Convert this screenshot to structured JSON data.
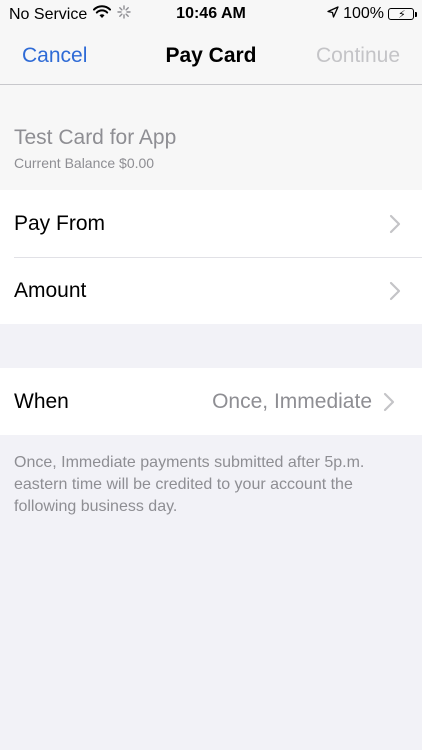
{
  "status_bar": {
    "carrier": "No Service",
    "time": "10:46 AM",
    "battery": "100%",
    "battery_level": 1.0,
    "battery_color": "#3bd34a"
  },
  "nav": {
    "cancel_label": "Cancel",
    "title": "Pay Card",
    "continue_label": "Continue",
    "accent_color": "#2f6bd6"
  },
  "card": {
    "name": "Test Card for App",
    "balance": "Current Balance $0.00"
  },
  "rows": {
    "pay_from_label": "Pay From",
    "amount_label": "Amount",
    "when_label": "When",
    "when_value": "Once, Immediate"
  },
  "footer_note": "Once, Immediate payments submitted after 5p.m. eastern time will be credited to your account the following business day.",
  "icons": [
    "wifi-icon",
    "activity-spinner-icon",
    "location-arrow-icon",
    "battery-icon",
    "chevron-right-icon"
  ]
}
